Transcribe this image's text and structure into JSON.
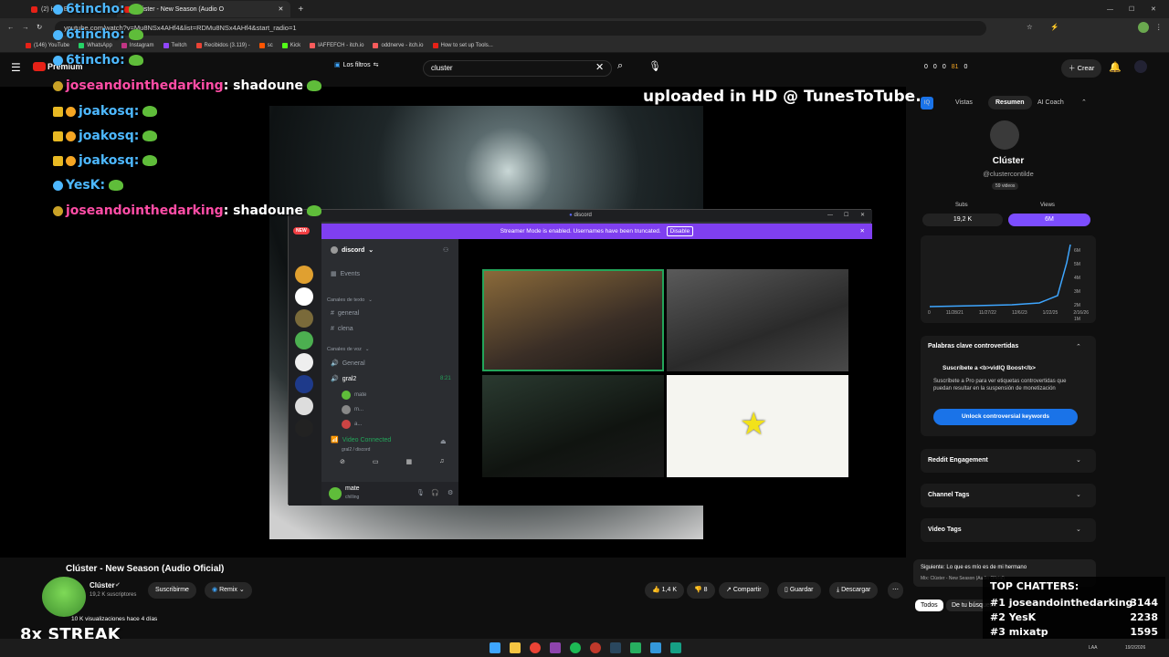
{
  "browser": {
    "tabs": [
      {
        "label": "(2) Haz E...",
        "active": false
      },
      {
        "label": "Clúster - New Season (Audio O",
        "active": true
      }
    ],
    "url": "youtube.com/watch?v=Mu8NSx4AHf4&list=RDMu8NSx4AHf4&start_radio=1",
    "bookmarks": [
      "(146) YouTube",
      "WhatsApp",
      "Instagram",
      "Twitch",
      "Recibidos (3.119) -",
      "sc",
      "Kick",
      "IAFFEFCH - itch.io",
      "oddnerve - itch.io",
      "How to set up Tools..."
    ]
  },
  "youtube": {
    "logo": "Premium",
    "filters_label": "Los filtros",
    "search_value": "cluster",
    "create_label": "Crear",
    "header_counts": [
      "0",
      "0",
      "0",
      "81",
      "0"
    ]
  },
  "player": {
    "hd_text": "uploaded in HD @ TunesToTube.com"
  },
  "discord": {
    "title": "discord",
    "banner": "Streamer Mode is enabled. Usernames have been truncated.",
    "banner_button": "Disable",
    "server_name": "discord",
    "new_badge": "NEW",
    "events": "Events",
    "text_section": "Canales de texto",
    "text_channels": [
      "general",
      "clena"
    ],
    "voice_section": "Canales de voz",
    "voice_channels": [
      "General",
      "gral2"
    ],
    "call_timer": "8:21",
    "voice_users": [
      "mate",
      "m...",
      "a..."
    ],
    "video_connected": "Video Connected",
    "video_sub": "gral2 / discord",
    "user_name": "mate",
    "user_status": "chilling"
  },
  "chat_overlay": [
    {
      "user": "6tincho:",
      "color": "blue",
      "message": ""
    },
    {
      "user": "6tincho:",
      "color": "blue",
      "message": ""
    },
    {
      "user": "6tincho:",
      "color": "blue",
      "message": ""
    },
    {
      "user": "joseandointhedarking",
      "color": "pink",
      "message": ": shadoune"
    },
    {
      "user": "joakosq:",
      "color": "blue",
      "message": ""
    },
    {
      "user": "joakosq:",
      "color": "blue",
      "message": ""
    },
    {
      "user": "joakosq:",
      "color": "blue",
      "message": ""
    },
    {
      "user": "YesK:",
      "color": "blue",
      "message": ""
    },
    {
      "user": "joseandointhedarking",
      "color": "pink",
      "message": ": shadoune"
    }
  ],
  "vidiq": {
    "tabs": [
      "Vistas",
      "Resumen",
      "AI Coach"
    ],
    "active_tab": "Resumen",
    "channel_name": "Clúster",
    "channel_handle": "@clustercontilde",
    "videos": "59 videos",
    "subs_label": "Subs",
    "subs_value": "19,2 K",
    "views_label": "Views",
    "views_value": "6M",
    "chart_y": [
      "6M",
      "5M",
      "4M",
      "3M",
      "2M",
      "1M",
      "0"
    ],
    "chart_x": [
      "0",
      "11/28/21",
      "11/27/22",
      "12/6/23",
      "1/22/25",
      "2/16/26"
    ],
    "keywords_title": "Palabras clave controvertidas",
    "boost_title": "Suscríbete a <b>vidIQ Boost</b>",
    "boost_text": "Suscríbete a Pro para ver etiquetas controvertidas que puedan resultar en la suspensión de monetización",
    "unlock_button": "Unlock controversial keywords",
    "sections": [
      "Reddit Engagement",
      "Channel Tags",
      "Video Tags"
    ]
  },
  "video": {
    "title": "Clúster - New Season (Audio Oficial)",
    "channel": "Clúster",
    "subs": "19,2 K suscriptores",
    "subscribe": "Suscribirme",
    "remix": "Remix",
    "likes": "1,4 K",
    "dislikes": "8",
    "share": "Compartir",
    "save": "Guardar",
    "download": "Descargar",
    "views": "10 K visualizaciones  hace 4 días"
  },
  "up_next": {
    "label": "Siguiente: Lo que es mío es de mi hermano",
    "mix": "Mix: Clúster - New Season (Audio Oficial)",
    "chips": [
      "Todos",
      "De tu búsqueda"
    ]
  },
  "top_chatters": {
    "title": "TOP CHATTERS:",
    "rows": [
      {
        "rank": "#1",
        "name": "joseandointhedarking",
        "count": "3144"
      },
      {
        "rank": "#2",
        "name": "YesK",
        "count": "2238"
      },
      {
        "rank": "#3",
        "name": "mixatp",
        "count": "1595"
      }
    ]
  },
  "streak": "8x STREAK",
  "clock": {
    "lang": "LAA",
    "date": "19/2/2026"
  }
}
